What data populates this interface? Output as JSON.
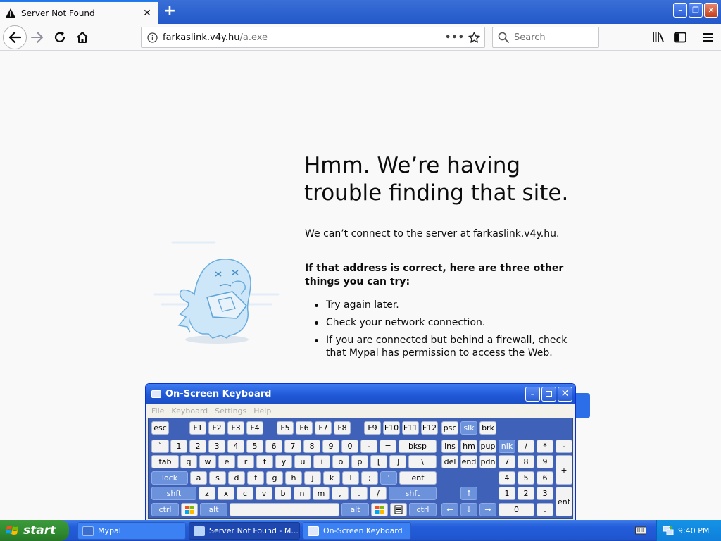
{
  "browser": {
    "tab_title": "Server Not Found",
    "tab_close": "✕",
    "new_tab": "+",
    "url_host": "farkaslink.v4y.hu",
    "url_path": "/a.exe",
    "page_actions": "•••",
    "search_placeholder": "Search"
  },
  "window": {
    "minimize": "–",
    "restore": "❐",
    "close": "✕"
  },
  "error_page": {
    "title": "Hmm. We’re having trouble finding that site.",
    "description": "We can’t connect to the server at farkaslink.v4y.hu.",
    "subtitle": "If that address is correct, here are three other things you can try:",
    "suggestions": [
      "Try again later.",
      "Check your network connection.",
      "If you are connected but behind a firewall, check that Mypal has permission to access the Web."
    ]
  },
  "osk": {
    "title": "On-Screen Keyboard",
    "menu": [
      "File",
      "Keyboard",
      "Settings",
      "Help"
    ],
    "rows": [
      [
        "esc",
        "F1",
        "F2",
        "F3",
        "F4",
        "F5",
        "F6",
        "F7",
        "F8",
        "F9",
        "F10",
        "F11",
        "F12",
        "psc",
        "slk",
        "brk"
      ],
      [
        "`",
        "1",
        "2",
        "3",
        "4",
        "5",
        "6",
        "7",
        "8",
        "9",
        "0",
        "-",
        "=",
        "bksp",
        "ins",
        "hm",
        "pup",
        "nlk",
        "/",
        "*",
        "-"
      ],
      [
        "tab",
        "q",
        "w",
        "e",
        "r",
        "t",
        "y",
        "u",
        "i",
        "o",
        "p",
        "[",
        "]",
        "\\",
        "del",
        "end",
        "pdn",
        "7",
        "8",
        "9",
        "+"
      ],
      [
        "lock",
        "a",
        "s",
        "d",
        "f",
        "g",
        "h",
        "j",
        "k",
        "l",
        ";",
        "'",
        "ent",
        "4",
        "5",
        "6"
      ],
      [
        "shft",
        "z",
        "x",
        "c",
        "v",
        "b",
        "n",
        "m",
        ",",
        ".",
        "/",
        "shft",
        "↑",
        "1",
        "2",
        "3",
        "ent"
      ],
      [
        "ctrl",
        "",
        "alt",
        "",
        "alt",
        "",
        "",
        "ctrl",
        "←",
        "↓",
        "→",
        "0",
        "."
      ]
    ]
  },
  "taskbar": {
    "start": "start",
    "buttons": [
      "Mypal",
      "Server Not Found - M...",
      "On-Screen Keyboard"
    ],
    "clock": "9:40 PM"
  },
  "colors": {
    "xp_blue": "#245edb",
    "start_green": "#2f8a2f",
    "page_bg": "#f9f9fa",
    "key_blue": "#6d92dc"
  }
}
